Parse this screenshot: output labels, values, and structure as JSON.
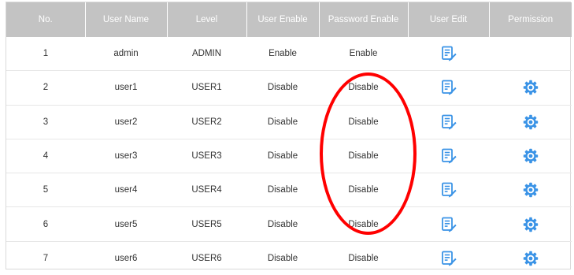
{
  "table": {
    "headers": [
      "No.",
      "User Name",
      "Level",
      "User Enable",
      "Password Enable",
      "User Edit",
      "Permission"
    ],
    "rows": [
      {
        "no": "1",
        "user_name": "admin",
        "level": "ADMIN",
        "user_enable": "Enable",
        "password_enable": "Enable",
        "edit_icon": "edit-icon",
        "permission_icon": ""
      },
      {
        "no": "2",
        "user_name": "user1",
        "level": "USER1",
        "user_enable": "Disable",
        "password_enable": "Disable",
        "edit_icon": "edit-icon",
        "permission_icon": "gear-icon"
      },
      {
        "no": "3",
        "user_name": "user2",
        "level": "USER2",
        "user_enable": "Disable",
        "password_enable": "Disable",
        "edit_icon": "edit-icon",
        "permission_icon": "gear-icon"
      },
      {
        "no": "4",
        "user_name": "user3",
        "level": "USER3",
        "user_enable": "Disable",
        "password_enable": "Disable",
        "edit_icon": "edit-icon",
        "permission_icon": "gear-icon"
      },
      {
        "no": "5",
        "user_name": "user4",
        "level": "USER4",
        "user_enable": "Disable",
        "password_enable": "Disable",
        "edit_icon": "edit-icon",
        "permission_icon": "gear-icon"
      },
      {
        "no": "6",
        "user_name": "user5",
        "level": "USER5",
        "user_enable": "Disable",
        "password_enable": "Disable",
        "edit_icon": "edit-icon",
        "permission_icon": "gear-icon"
      },
      {
        "no": "7",
        "user_name": "user6",
        "level": "USER6",
        "user_enable": "Disable",
        "password_enable": "Disable",
        "edit_icon": "edit-icon",
        "permission_icon": "gear-icon"
      }
    ]
  },
  "colors": {
    "header_bg": "#c3c3c3",
    "icon_blue": "#3a93e6",
    "annotation": "#ff0000"
  }
}
